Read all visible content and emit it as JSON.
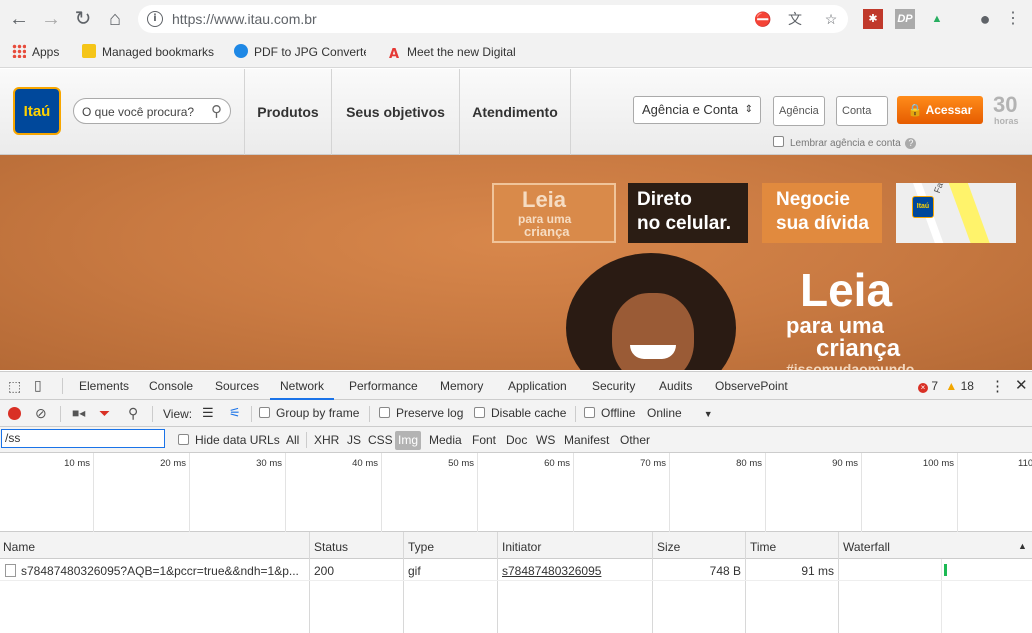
{
  "browser": {
    "url": "https://www.itau.com.br",
    "ext_ip": "DP"
  },
  "bookmarks": [
    {
      "label": "Apps"
    },
    {
      "label": "Managed bookmarks"
    },
    {
      "label": "PDF to JPG Converter"
    },
    {
      "label": "Meet the new Digital"
    }
  ],
  "site": {
    "logo": "Itaú",
    "search_placeholder": "O que você procura?",
    "nav": [
      "Produtos",
      "Seus objetivos",
      "Atendimento"
    ],
    "login_select": "Agência e Conta",
    "agencia_placeholder": "Agência",
    "conta_placeholder": "Conta",
    "submit": "Acessar",
    "thirty": "30",
    "horas": "horas",
    "remember": "Lembrar agência e conta"
  },
  "hero": {
    "tiles": [
      {
        "line1": "Leia",
        "line2": "para uma",
        "line3": "criança"
      },
      {
        "line1": "Direto",
        "line2": "no celular."
      },
      {
        "line1": "Negocie",
        "line2": "sua dívida"
      },
      {
        "street": "Faria Lima",
        "logo": "Itaú"
      }
    ],
    "headline1": "Leia",
    "headline2": "para uma",
    "headline3": "criança",
    "hashtag": "#issomudaomundo"
  },
  "devtools": {
    "tabs": [
      "Elements",
      "Console",
      "Sources",
      "Network",
      "Performance",
      "Memory",
      "Application",
      "Security",
      "Audits",
      "ObservePoint"
    ],
    "errors": "7",
    "warnings": "18",
    "view_label": "View:",
    "group_by_frame": "Group by frame",
    "preserve_log": "Preserve log",
    "disable_cache": "Disable cache",
    "offline": "Offline",
    "throttle": "Online",
    "filter_value": "/ss",
    "hide_data_urls": "Hide data URLs",
    "filter_types": [
      "All",
      "XHR",
      "JS",
      "CSS",
      "Img",
      "Media",
      "Font",
      "Doc",
      "WS",
      "Manifest",
      "Other"
    ],
    "timeline_ticks": [
      "10 ms",
      "20 ms",
      "30 ms",
      "40 ms",
      "50 ms",
      "60 ms",
      "70 ms",
      "80 ms",
      "90 ms",
      "100 ms",
      "110"
    ],
    "columns": [
      "Name",
      "Status",
      "Type",
      "Initiator",
      "Size",
      "Time",
      "Waterfall"
    ],
    "rows": [
      {
        "name": "s78487480326095?AQB=1&pccr=true&&ndh=1&p...",
        "status": "200",
        "type": "gif",
        "initiator": "s78487480326095",
        "size": "748 B",
        "time": "91 ms"
      }
    ]
  },
  "colors": {
    "brand_blue": "#00489b",
    "brand_yellow": "#ffd200",
    "accent_orange": "#ff7a00",
    "devtools_blue": "#1a73e8"
  }
}
